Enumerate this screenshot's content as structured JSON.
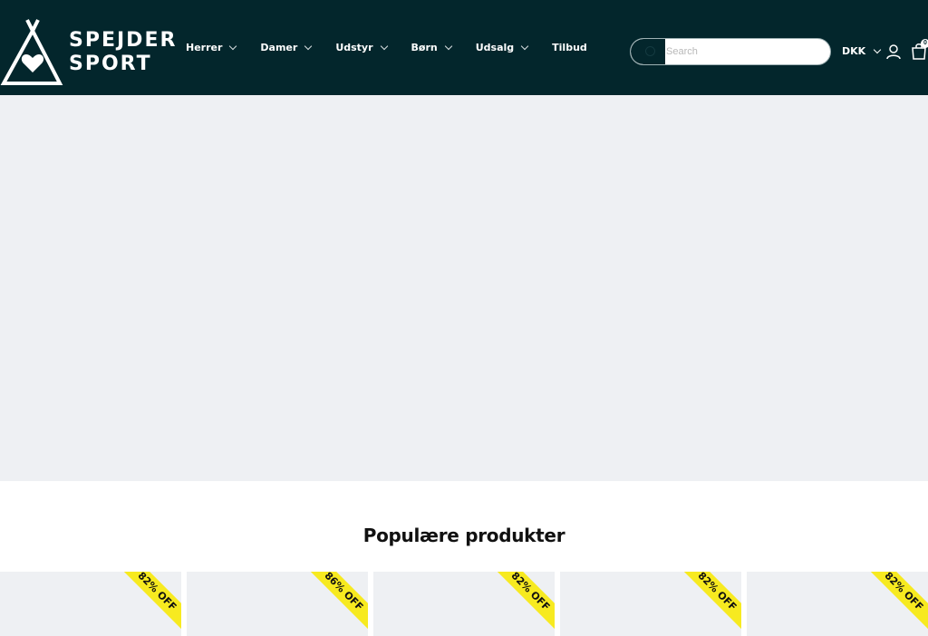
{
  "brand": {
    "name_line1": "SPEJDER",
    "name_line2": "SPORT"
  },
  "nav": {
    "items": [
      {
        "label": "Herrer",
        "dropdown": true
      },
      {
        "label": "Damer",
        "dropdown": true
      },
      {
        "label": "Udstyr",
        "dropdown": true
      },
      {
        "label": "Børn",
        "dropdown": true
      },
      {
        "label": "Udsalg",
        "dropdown": true
      },
      {
        "label": "Tilbud",
        "dropdown": false
      }
    ]
  },
  "search": {
    "placeholder": "Search",
    "value": ""
  },
  "header": {
    "currency": "DKK",
    "cart_count": "0"
  },
  "section": {
    "title": "Populære produkter"
  },
  "products": [
    {
      "badge": "82% OFF"
    },
    {
      "badge": "86% OFF"
    },
    {
      "badge": "82% OFF"
    },
    {
      "badge": "82% OFF"
    },
    {
      "badge": "82% OFF"
    }
  ],
  "colors": {
    "header_bg": "#03262c",
    "hero_bg": "#eef0f3",
    "badge": "#f7ea20"
  }
}
